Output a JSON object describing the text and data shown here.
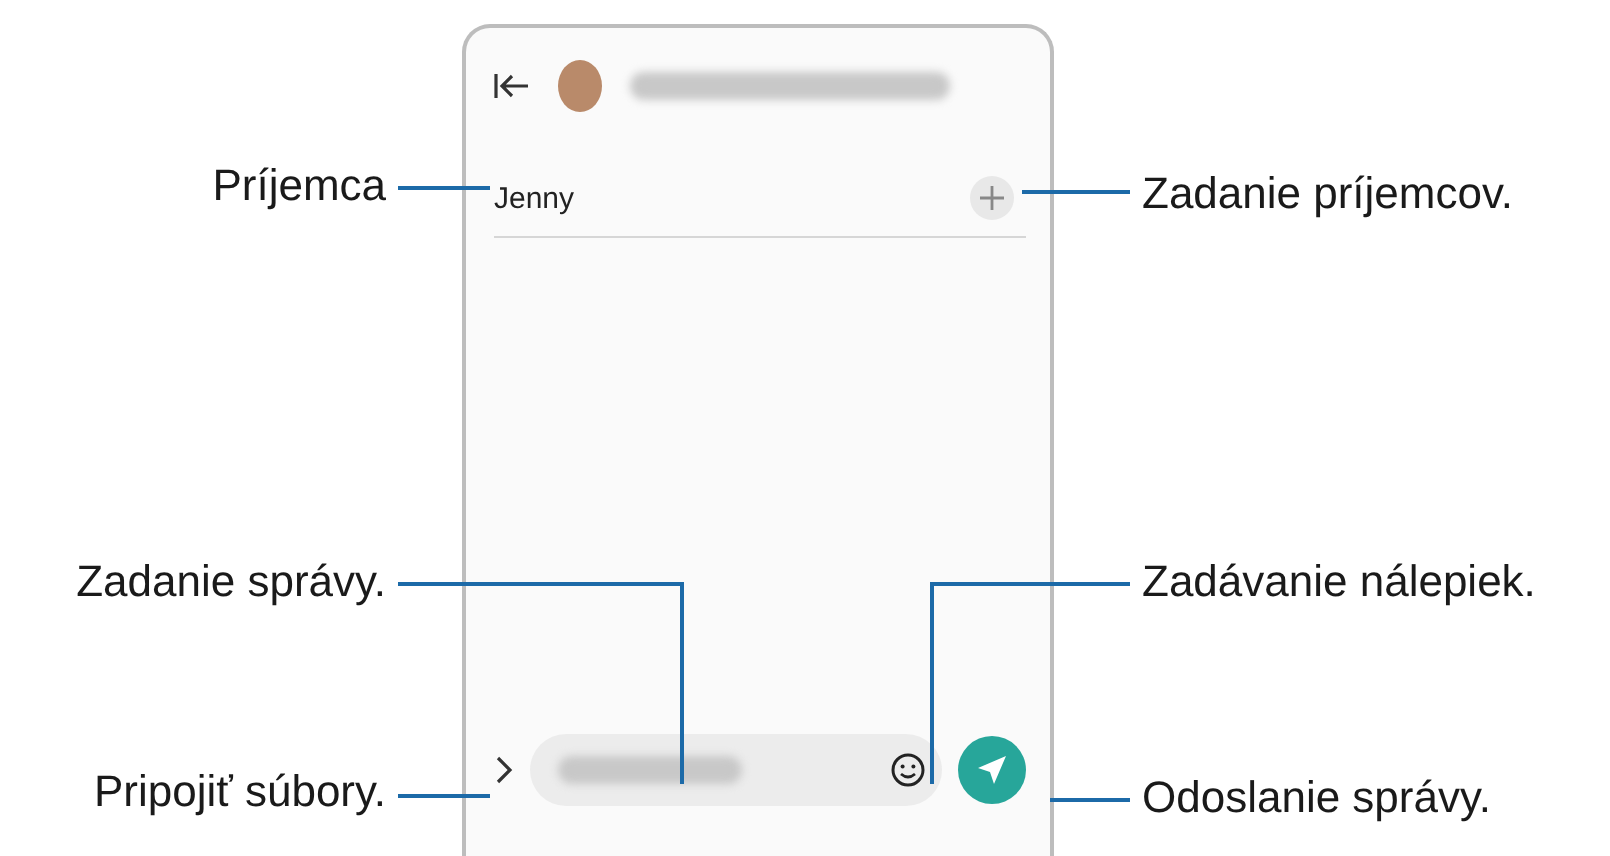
{
  "screen": {
    "recipient": "Jenny"
  },
  "left_callouts": [
    {
      "text": "Príjemca"
    },
    {
      "text": "Zadanie správy."
    },
    {
      "text": "Pripojiť súbory."
    }
  ],
  "right_callouts": [
    {
      "text": "Zadanie príjemcov."
    },
    {
      "text": "Zadávanie nálepiek."
    },
    {
      "text": "Odoslanie správy."
    }
  ]
}
